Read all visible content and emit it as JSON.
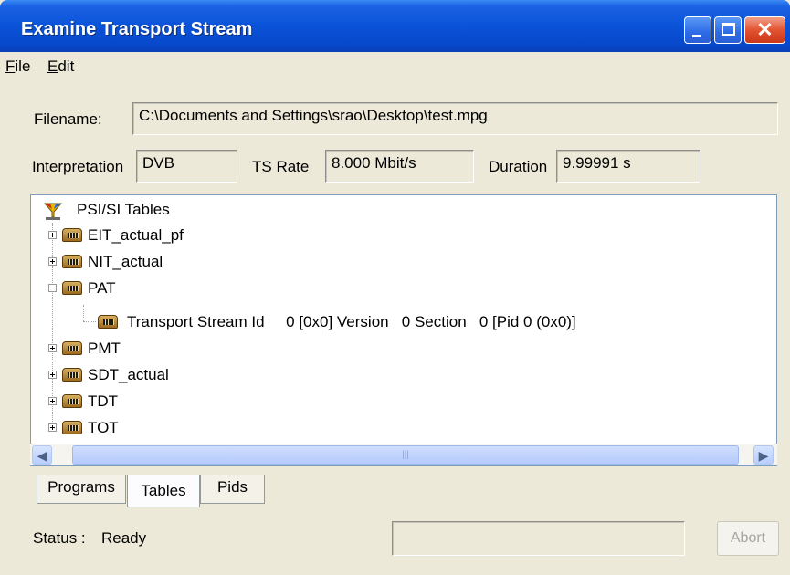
{
  "window": {
    "title": "Examine Transport Stream"
  },
  "menu": {
    "items": [
      "File",
      "Edit"
    ]
  },
  "form": {
    "filename_label": "Filename:",
    "filename_value": "C:\\Documents and Settings\\srao\\Desktop\\test.mpg",
    "interpretation_label": "Interpretation",
    "interpretation_value": "DVB",
    "ts_rate_label": "TS Rate",
    "ts_rate_value": "8.000 Mbit/s",
    "duration_label": "Duration",
    "duration_value": "9.99991 s"
  },
  "tree": {
    "root": "PSI/SI Tables",
    "nodes": [
      {
        "label": "EIT_actual_pf",
        "expanded": false
      },
      {
        "label": "NIT_actual",
        "expanded": false
      },
      {
        "label": "PAT",
        "expanded": true,
        "children": [
          "Transport Stream Id     0 [0x0] Version   0 Section   0 [Pid 0 (0x0)]"
        ]
      },
      {
        "label": "PMT",
        "expanded": false
      },
      {
        "label": "SDT_actual",
        "expanded": false
      },
      {
        "label": "TDT",
        "expanded": false
      },
      {
        "label": "TOT",
        "expanded": false
      }
    ]
  },
  "tabs": [
    "Programs",
    "Tables",
    "Pids"
  ],
  "active_tab": "Tables",
  "status": {
    "label": "Status :",
    "value": "Ready"
  },
  "buttons": {
    "abort": "Abort"
  },
  "icons": [
    "minimize-icon",
    "maximize-icon",
    "close-icon",
    "tree-root-icon",
    "table-icon",
    "scroll-left-icon",
    "scroll-right-icon"
  ]
}
